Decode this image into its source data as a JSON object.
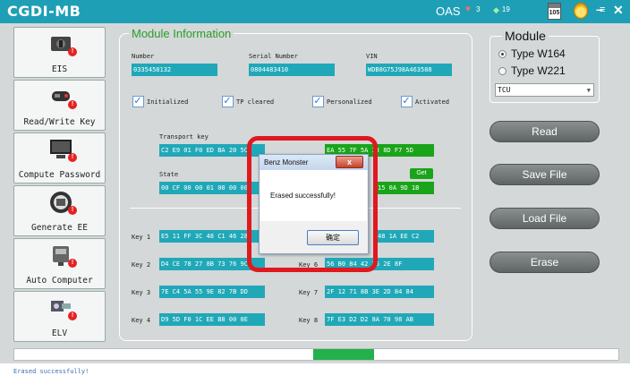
{
  "app": {
    "title": "CGDI-MB",
    "oas": "OAS",
    "hearts": "3",
    "diamonds": "19",
    "calendar": "105"
  },
  "sidebar": {
    "items": [
      {
        "label": "EIS",
        "icon": "ignition-switch-icon"
      },
      {
        "label": "Read/Write Key",
        "icon": "car-key-icon"
      },
      {
        "label": "Compute Password",
        "icon": "computer-icon"
      },
      {
        "label": "Generate EE",
        "icon": "chip-programmer-icon"
      },
      {
        "label": "Auto Computer",
        "icon": "diagnostic-device-icon"
      },
      {
        "label": "ELV",
        "icon": "steering-lock-icon"
      }
    ]
  },
  "module_info": {
    "title": "Module Information",
    "number_label": "Number",
    "number_value": "0335458132",
    "serial_label": "Serial Number",
    "serial_value": "0804483410",
    "vin_label": "VIN",
    "vin_value": "WDB8G75J98A463588",
    "checks": [
      "Initialized",
      "TP cleared",
      "Personalized",
      "Activated"
    ],
    "transport_label": "Transport key",
    "transport_value": "C2 E9 01 F0 ED BA 20 5C",
    "transport_right": "EA 55 7F 5A 33 8D F7 5D",
    "state_label": "State",
    "state_value": "00 CF 00 00 01 00 00 00",
    "state_right": "15 0A 9D 1B",
    "get_label": "Get",
    "keys": [
      {
        "label": "Key 1",
        "value": "E5 11 FF 3C 48 C1 46 28",
        "right_label": "",
        "right_value": "48 1A EE C2"
      },
      {
        "label": "Key 2",
        "value": "D4 CE 78 27 8B 73 76 9C",
        "right_label": "Key 6",
        "right_value": "56 B0 84 42 26 2E 8F"
      },
      {
        "label": "Key 3",
        "value": "7E C4 5A 55 9E 82 7B DD",
        "right_label": "Key 7",
        "right_value": "2F 12 71 8B 3E 2D 84 84"
      },
      {
        "label": "Key 4",
        "value": "D9 5D F0 1C EE B8 00 0E",
        "right_label": "Key 8",
        "right_value": "7F E3 D2 D2 8A 70 98 AB"
      }
    ]
  },
  "module": {
    "title": "Module",
    "options": [
      "Type W164",
      "Type W221"
    ],
    "selected": "Type W164",
    "select_value": "TCU"
  },
  "actions": {
    "read": "Read",
    "save": "Save File",
    "load": "Load File",
    "erase": "Erase"
  },
  "dialog": {
    "title": "Benz Monster",
    "message": "Erased successfully!",
    "ok": "确定",
    "close": "x"
  },
  "progress": {
    "fraction": 0.1
  },
  "status": {
    "text": "Erased successfully!"
  }
}
